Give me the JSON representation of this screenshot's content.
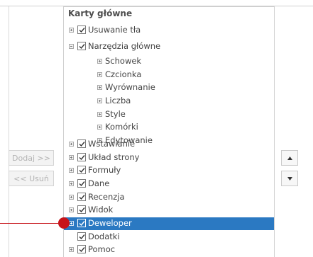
{
  "tree": {
    "header": "Karty główne",
    "items": [
      {
        "label": "Usuwanie tła",
        "checked": true,
        "expander": "plus"
      },
      {
        "label": "Narzędzia główne",
        "checked": true,
        "expander": "minus"
      },
      {
        "label": "Schowek",
        "expander": "plus"
      },
      {
        "label": "Czcionka",
        "expander": "plus"
      },
      {
        "label": "Wyrównanie",
        "expander": "plus"
      },
      {
        "label": "Liczba",
        "expander": "plus"
      },
      {
        "label": "Style",
        "expander": "plus"
      },
      {
        "label": "Komórki",
        "expander": "plus"
      },
      {
        "label": "Edytowanie",
        "expander": "plus"
      },
      {
        "label": "Wstawianie",
        "checked": true,
        "expander": "plus"
      },
      {
        "label": "Układ strony",
        "checked": true,
        "expander": "plus"
      },
      {
        "label": "Formuły",
        "checked": true,
        "expander": "plus"
      },
      {
        "label": "Dane",
        "checked": true,
        "expander": "plus"
      },
      {
        "label": "Recenzja",
        "checked": true,
        "expander": "plus"
      },
      {
        "label": "Widok",
        "checked": true,
        "expander": "plus"
      },
      {
        "label": "Deweloper",
        "checked": true,
        "expander": "plus",
        "selected": true
      },
      {
        "label": "Dodatki",
        "checked": true,
        "expander": "none"
      },
      {
        "label": "Pomoc",
        "checked": true,
        "expander": "plus"
      }
    ]
  },
  "buttons": {
    "add": "Dodaj >>",
    "remove": "<< Usuń",
    "move_up_icon": "triangle-up-icon",
    "move_down_icon": "triangle-down-icon"
  },
  "colors": {
    "selection": "#2b79c2",
    "callout": "#c7141a"
  }
}
